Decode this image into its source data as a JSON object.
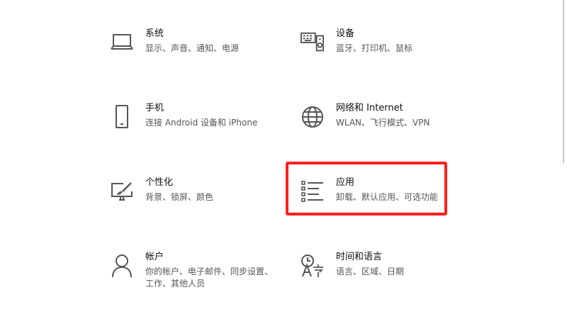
{
  "tiles": [
    {
      "id": "system",
      "title": "系统",
      "desc": "显示、声音、通知、电源",
      "icon": "laptop-icon"
    },
    {
      "id": "devices",
      "title": "设备",
      "desc": "蓝牙、打印机、鼠标",
      "icon": "keyboard-speaker-icon"
    },
    {
      "id": "phone",
      "title": "手机",
      "desc": "连接 Android 设备和 iPhone",
      "icon": "phone-icon"
    },
    {
      "id": "network",
      "title": "网络和 Internet",
      "desc": "WLAN、飞行模式、VPN",
      "icon": "globe-icon"
    },
    {
      "id": "personalization",
      "title": "个性化",
      "desc": "背景、锁屏、颜色",
      "icon": "paint-brush-icon"
    },
    {
      "id": "apps",
      "title": "应用",
      "desc": "卸载、默认应用、可选功能",
      "icon": "apps-list-icon"
    },
    {
      "id": "accounts",
      "title": "帐户",
      "desc": "你的帐户、电子邮件、同步设置、工作、其他人员",
      "icon": "person-icon"
    },
    {
      "id": "time-language",
      "title": "时间和语言",
      "desc": "语言、区域、日期",
      "icon": "time-language-icon"
    }
  ],
  "highlight_color": "#ff1e1e",
  "icon_color": "#555555"
}
